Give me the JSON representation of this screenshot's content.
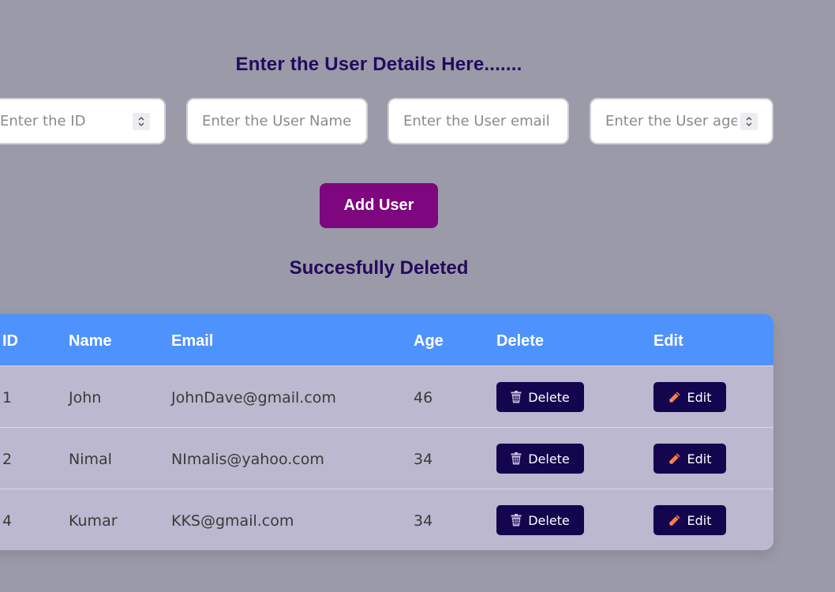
{
  "page": {
    "title": "Enter the User Details Here.......",
    "status_message": "Succesfully Deleted"
  },
  "form": {
    "id_placeholder": "Enter the ID",
    "name_placeholder": "Enter the User Name",
    "email_placeholder": "Enter the User email",
    "age_placeholder": "Enter the User age",
    "submit_label": "Add User"
  },
  "table": {
    "headers": {
      "id": "ID",
      "name": "Name",
      "email": "Email",
      "age": "Age",
      "delete": "Delete",
      "edit": "Edit"
    },
    "rows": [
      {
        "id": "1",
        "name": "John",
        "email": "JohnDave@gmail.com",
        "age": "46"
      },
      {
        "id": "2",
        "name": "Nimal",
        "email": "NImalis@yahoo.com",
        "age": "34"
      },
      {
        "id": "4",
        "name": "Kumar",
        "email": "KKS@gmail.com",
        "age": "34"
      }
    ],
    "delete_label": "Delete",
    "edit_label": "Edit"
  },
  "icons": {
    "delete": "trash-icon",
    "edit": "pencil-icon",
    "spinner": "chevron-up-down-icon"
  },
  "colors": {
    "background": "#9b9aa8",
    "heading": "#230a5e",
    "add_button": "#7e067e",
    "table_header": "#4e92fd",
    "table_body": "#bbb8cf",
    "row_button": "#13064f",
    "edit_icon": "#ff7a45"
  }
}
